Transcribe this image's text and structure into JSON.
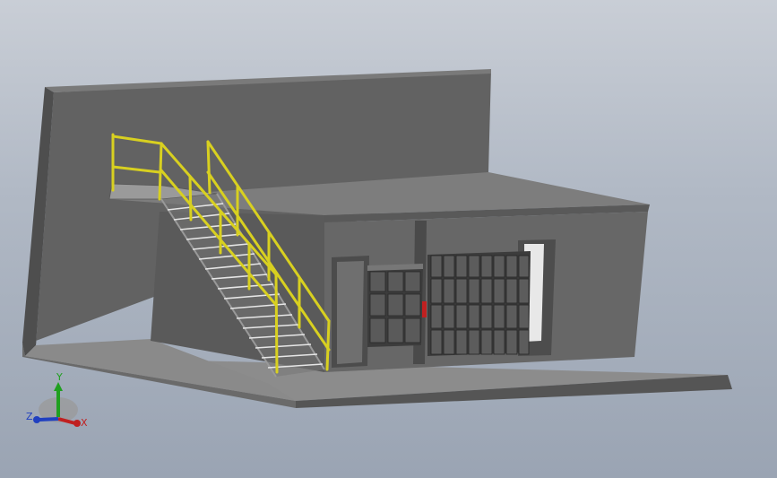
{
  "scene": {
    "model": "stair-platform-building",
    "colors": {
      "background_top": "#c9ced6",
      "background_bottom": "#9aa4b3",
      "wall": "#5f5f5f",
      "wall_dark": "#4a4a4a",
      "slab": "#8a8a8a",
      "railing": "#d8d020",
      "cabinet": "#3e3e3e",
      "extinguisher": "#c02020"
    }
  },
  "triad": {
    "x_label": "X",
    "y_label": "Y",
    "z_label": "Z",
    "x_color": "#c02020",
    "y_color": "#20a020",
    "z_color": "#2040c0"
  }
}
